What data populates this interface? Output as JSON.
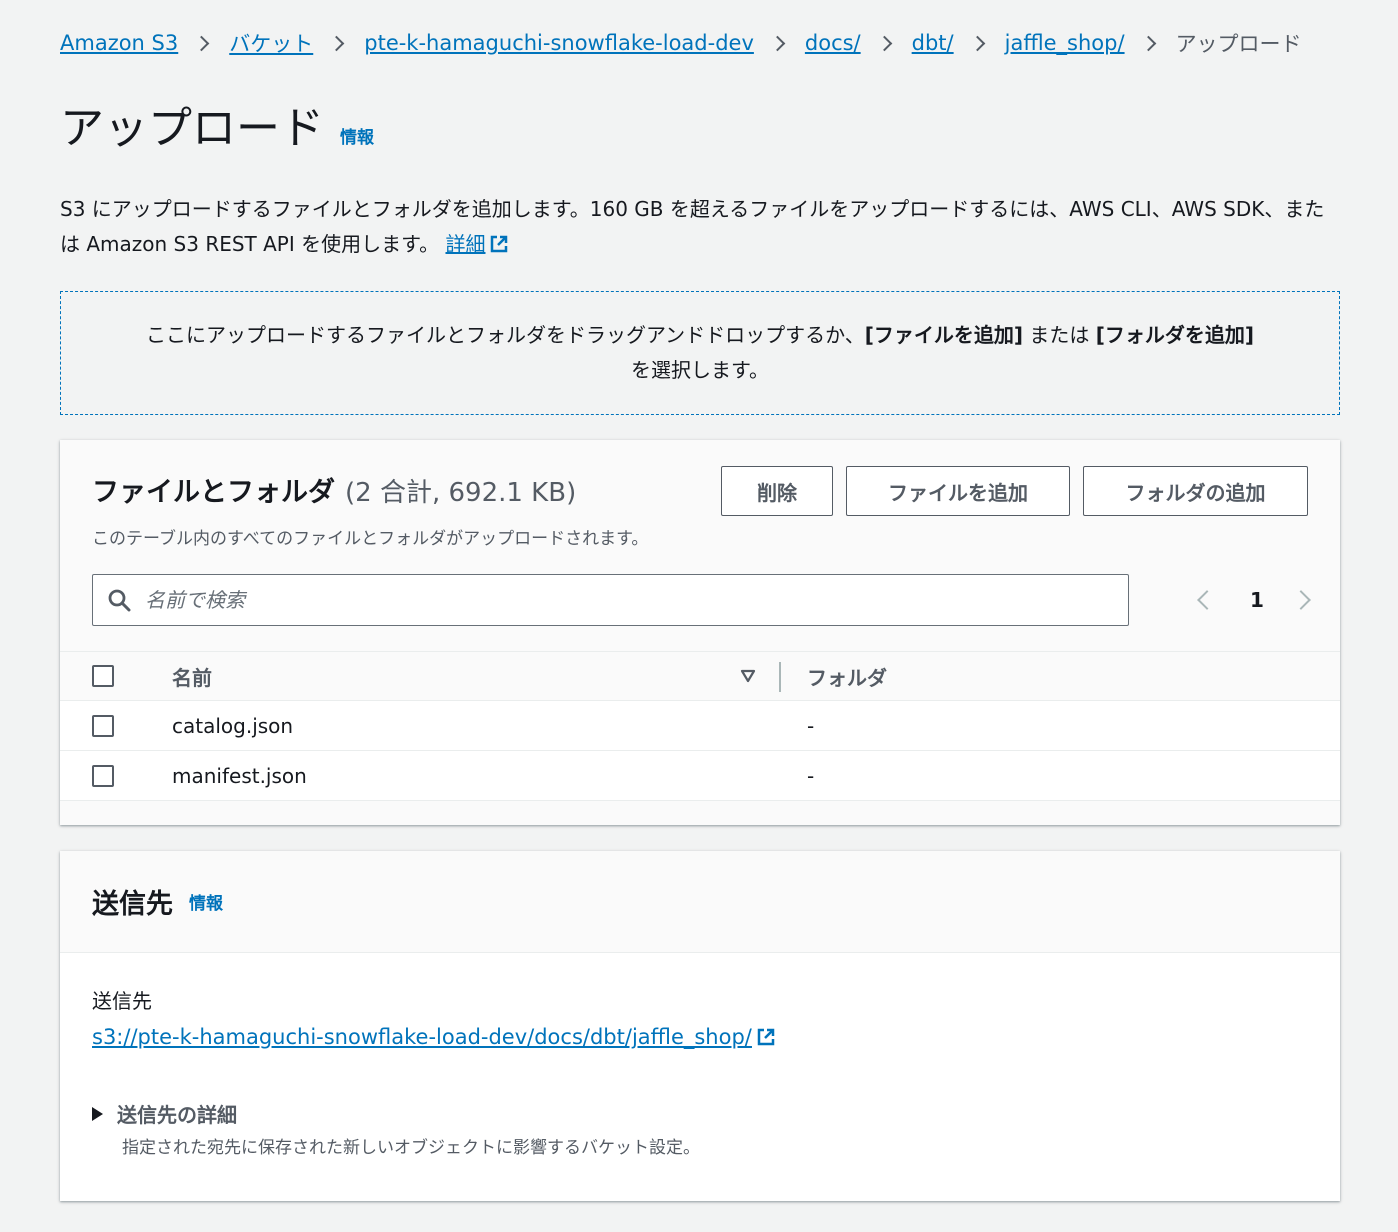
{
  "breadcrumb": {
    "items": [
      "Amazon S3",
      "バケット",
      "pte-k-hamaguchi-snowflake-load-dev",
      "docs/",
      "dbt/",
      "jaffle_shop/"
    ],
    "current": "アップロード"
  },
  "page": {
    "title": "アップロード",
    "info": "情報",
    "description": "S3 にアップロードするファイルとフォルダを追加します。160 GB を超えるファイルをアップロードするには、AWS CLI、AWS SDK、または Amazon S3 REST API を使用します。",
    "learn_more": "詳細"
  },
  "dropzone": {
    "text_before": "ここにアップロードするファイルとフォルダをドラッグアンドドロップするか、",
    "add_files": "[ファイルを追加]",
    "or": " または ",
    "add_folder": "[フォルダを追加]",
    "text_after": "を選択します。"
  },
  "files_panel": {
    "title": "ファイルとフォルダ",
    "count": "(2 合計, 692.1 KB)",
    "subtitle": "このテーブル内のすべてのファイルとフォルダがアップロードされます。",
    "buttons": {
      "delete": "削除",
      "add_files": "ファイルを追加",
      "add_folder": "フォルダの追加"
    },
    "search": {
      "placeholder": "名前で検索",
      "value": ""
    },
    "pagination": {
      "current": "1"
    },
    "columns": {
      "name": "名前",
      "folder": "フォルダ"
    },
    "rows": [
      {
        "name": "catalog.json",
        "folder": "-"
      },
      {
        "name": "manifest.json",
        "folder": "-"
      }
    ]
  },
  "destination": {
    "title": "送信先",
    "info": "情報",
    "label": "送信先",
    "url": "s3://pte-k-hamaguchi-snowflake-load-dev/docs/dbt/jaffle_shop/",
    "details_title": "送信先の詳細",
    "details_sub": "指定された宛先に保存された新しいオブジェクトに影響するバケット設定。"
  },
  "colors": {
    "link": "#0073bb",
    "text": "#16191f",
    "secondary": "#545b64",
    "background": "#f2f3f3"
  },
  "icons": {
    "breadcrumb_separator": "chevron-right-icon",
    "external_link": "external-link-icon",
    "search": "search-icon",
    "sort": "sort-down-icon",
    "expand": "caret-right-icon"
  }
}
